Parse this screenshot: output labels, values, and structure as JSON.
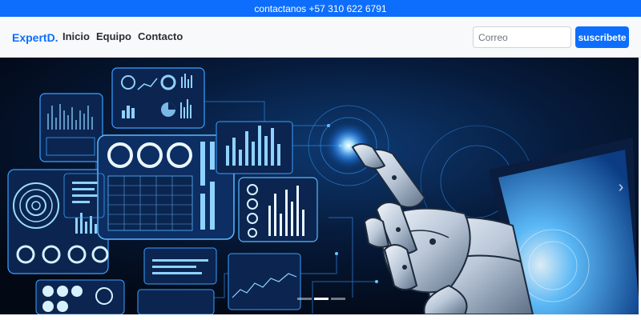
{
  "topbar": {
    "text": "contactanos +57 310 622 6791"
  },
  "navbar": {
    "brand": "ExpertD.",
    "links": [
      {
        "label": "Inicio"
      },
      {
        "label": "Equipo"
      },
      {
        "label": "Contacto"
      }
    ],
    "subscribe": {
      "placeholder": "Correo",
      "value": "",
      "button_label": "suscribete"
    }
  },
  "hero": {
    "image_subject": "robot hand touching holographic data dashboard",
    "slides_count": 3,
    "active_slide": 2,
    "next_icon": "chevron-right-icon"
  },
  "colors": {
    "primary": "#0d6efd",
    "navbar_bg": "#f8f9fa",
    "hero_bg": "#030b1c",
    "hologram": "#5bb8ff"
  }
}
